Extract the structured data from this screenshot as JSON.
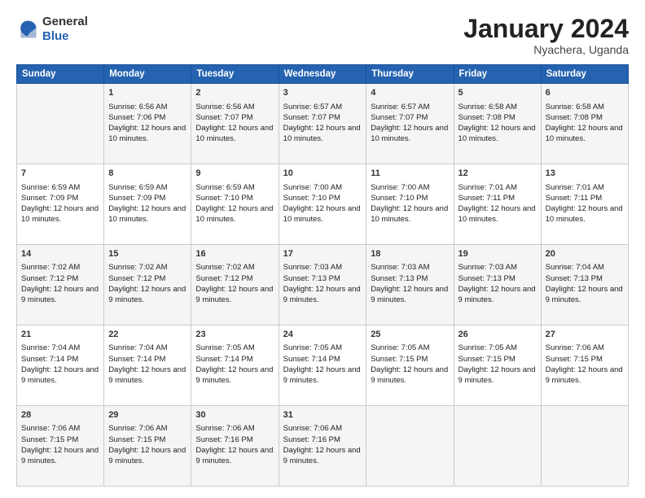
{
  "header": {
    "logo": {
      "general": "General",
      "blue": "Blue"
    },
    "title": "January 2024",
    "location": "Nyachera, Uganda"
  },
  "days_of_week": [
    "Sunday",
    "Monday",
    "Tuesday",
    "Wednesday",
    "Thursday",
    "Friday",
    "Saturday"
  ],
  "weeks": [
    [
      {
        "day": "",
        "sunrise": "",
        "sunset": "",
        "daylight": ""
      },
      {
        "day": "1",
        "sunrise": "Sunrise: 6:56 AM",
        "sunset": "Sunset: 7:06 PM",
        "daylight": "Daylight: 12 hours and 10 minutes."
      },
      {
        "day": "2",
        "sunrise": "Sunrise: 6:56 AM",
        "sunset": "Sunset: 7:07 PM",
        "daylight": "Daylight: 12 hours and 10 minutes."
      },
      {
        "day": "3",
        "sunrise": "Sunrise: 6:57 AM",
        "sunset": "Sunset: 7:07 PM",
        "daylight": "Daylight: 12 hours and 10 minutes."
      },
      {
        "day": "4",
        "sunrise": "Sunrise: 6:57 AM",
        "sunset": "Sunset: 7:07 PM",
        "daylight": "Daylight: 12 hours and 10 minutes."
      },
      {
        "day": "5",
        "sunrise": "Sunrise: 6:58 AM",
        "sunset": "Sunset: 7:08 PM",
        "daylight": "Daylight: 12 hours and 10 minutes."
      },
      {
        "day": "6",
        "sunrise": "Sunrise: 6:58 AM",
        "sunset": "Sunset: 7:08 PM",
        "daylight": "Daylight: 12 hours and 10 minutes."
      }
    ],
    [
      {
        "day": "7",
        "sunrise": "Sunrise: 6:59 AM",
        "sunset": "Sunset: 7:09 PM",
        "daylight": "Daylight: 12 hours and 10 minutes."
      },
      {
        "day": "8",
        "sunrise": "Sunrise: 6:59 AM",
        "sunset": "Sunset: 7:09 PM",
        "daylight": "Daylight: 12 hours and 10 minutes."
      },
      {
        "day": "9",
        "sunrise": "Sunrise: 6:59 AM",
        "sunset": "Sunset: 7:10 PM",
        "daylight": "Daylight: 12 hours and 10 minutes."
      },
      {
        "day": "10",
        "sunrise": "Sunrise: 7:00 AM",
        "sunset": "Sunset: 7:10 PM",
        "daylight": "Daylight: 12 hours and 10 minutes."
      },
      {
        "day": "11",
        "sunrise": "Sunrise: 7:00 AM",
        "sunset": "Sunset: 7:10 PM",
        "daylight": "Daylight: 12 hours and 10 minutes."
      },
      {
        "day": "12",
        "sunrise": "Sunrise: 7:01 AM",
        "sunset": "Sunset: 7:11 PM",
        "daylight": "Daylight: 12 hours and 10 minutes."
      },
      {
        "day": "13",
        "sunrise": "Sunrise: 7:01 AM",
        "sunset": "Sunset: 7:11 PM",
        "daylight": "Daylight: 12 hours and 10 minutes."
      }
    ],
    [
      {
        "day": "14",
        "sunrise": "Sunrise: 7:02 AM",
        "sunset": "Sunset: 7:12 PM",
        "daylight": "Daylight: 12 hours and 9 minutes."
      },
      {
        "day": "15",
        "sunrise": "Sunrise: 7:02 AM",
        "sunset": "Sunset: 7:12 PM",
        "daylight": "Daylight: 12 hours and 9 minutes."
      },
      {
        "day": "16",
        "sunrise": "Sunrise: 7:02 AM",
        "sunset": "Sunset: 7:12 PM",
        "daylight": "Daylight: 12 hours and 9 minutes."
      },
      {
        "day": "17",
        "sunrise": "Sunrise: 7:03 AM",
        "sunset": "Sunset: 7:13 PM",
        "daylight": "Daylight: 12 hours and 9 minutes."
      },
      {
        "day": "18",
        "sunrise": "Sunrise: 7:03 AM",
        "sunset": "Sunset: 7:13 PM",
        "daylight": "Daylight: 12 hours and 9 minutes."
      },
      {
        "day": "19",
        "sunrise": "Sunrise: 7:03 AM",
        "sunset": "Sunset: 7:13 PM",
        "daylight": "Daylight: 12 hours and 9 minutes."
      },
      {
        "day": "20",
        "sunrise": "Sunrise: 7:04 AM",
        "sunset": "Sunset: 7:13 PM",
        "daylight": "Daylight: 12 hours and 9 minutes."
      }
    ],
    [
      {
        "day": "21",
        "sunrise": "Sunrise: 7:04 AM",
        "sunset": "Sunset: 7:14 PM",
        "daylight": "Daylight: 12 hours and 9 minutes."
      },
      {
        "day": "22",
        "sunrise": "Sunrise: 7:04 AM",
        "sunset": "Sunset: 7:14 PM",
        "daylight": "Daylight: 12 hours and 9 minutes."
      },
      {
        "day": "23",
        "sunrise": "Sunrise: 7:05 AM",
        "sunset": "Sunset: 7:14 PM",
        "daylight": "Daylight: 12 hours and 9 minutes."
      },
      {
        "day": "24",
        "sunrise": "Sunrise: 7:05 AM",
        "sunset": "Sunset: 7:14 PM",
        "daylight": "Daylight: 12 hours and 9 minutes."
      },
      {
        "day": "25",
        "sunrise": "Sunrise: 7:05 AM",
        "sunset": "Sunset: 7:15 PM",
        "daylight": "Daylight: 12 hours and 9 minutes."
      },
      {
        "day": "26",
        "sunrise": "Sunrise: 7:05 AM",
        "sunset": "Sunset: 7:15 PM",
        "daylight": "Daylight: 12 hours and 9 minutes."
      },
      {
        "day": "27",
        "sunrise": "Sunrise: 7:06 AM",
        "sunset": "Sunset: 7:15 PM",
        "daylight": "Daylight: 12 hours and 9 minutes."
      }
    ],
    [
      {
        "day": "28",
        "sunrise": "Sunrise: 7:06 AM",
        "sunset": "Sunset: 7:15 PM",
        "daylight": "Daylight: 12 hours and 9 minutes."
      },
      {
        "day": "29",
        "sunrise": "Sunrise: 7:06 AM",
        "sunset": "Sunset: 7:15 PM",
        "daylight": "Daylight: 12 hours and 9 minutes."
      },
      {
        "day": "30",
        "sunrise": "Sunrise: 7:06 AM",
        "sunset": "Sunset: 7:16 PM",
        "daylight": "Daylight: 12 hours and 9 minutes."
      },
      {
        "day": "31",
        "sunrise": "Sunrise: 7:06 AM",
        "sunset": "Sunset: 7:16 PM",
        "daylight": "Daylight: 12 hours and 9 minutes."
      },
      {
        "day": "",
        "sunrise": "",
        "sunset": "",
        "daylight": ""
      },
      {
        "day": "",
        "sunrise": "",
        "sunset": "",
        "daylight": ""
      },
      {
        "day": "",
        "sunrise": "",
        "sunset": "",
        "daylight": ""
      }
    ]
  ]
}
